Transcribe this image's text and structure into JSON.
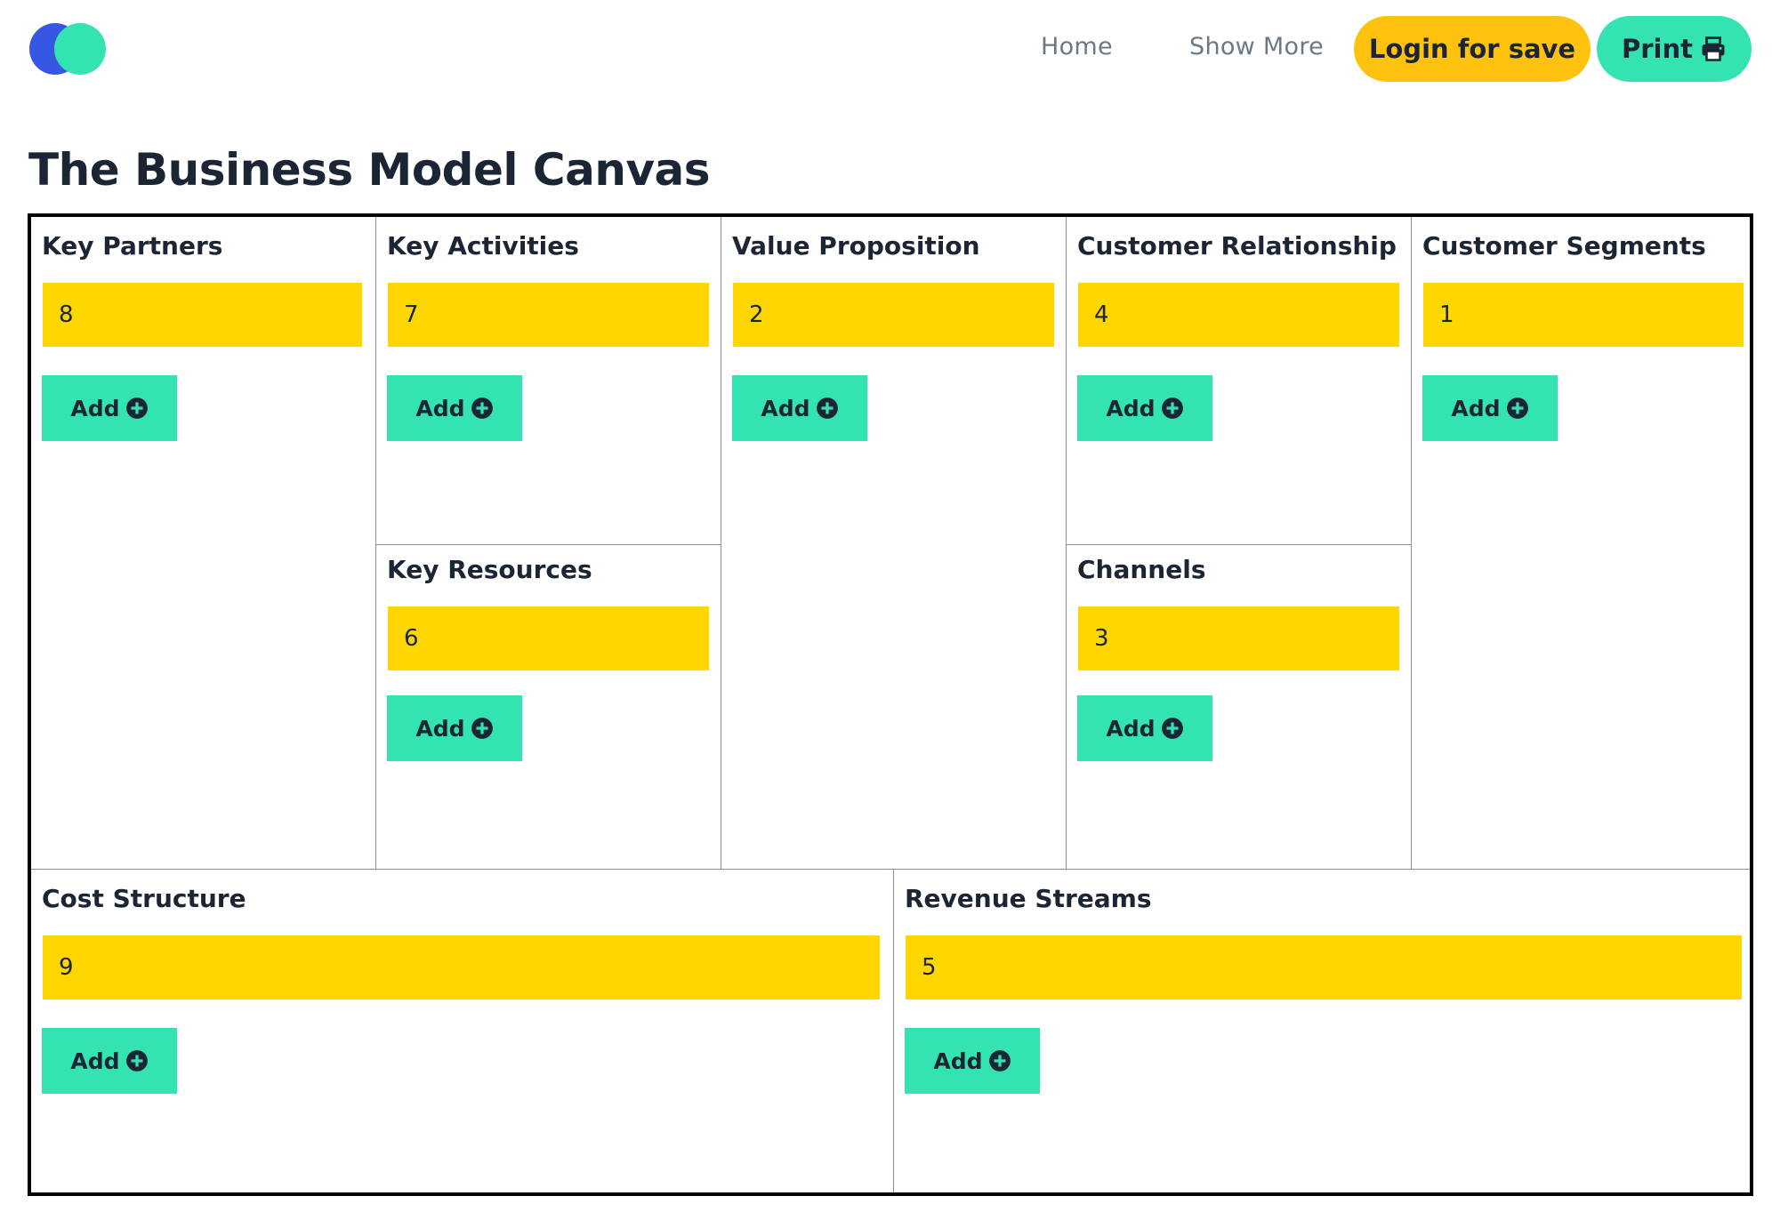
{
  "header": {
    "nav": {
      "home": "Home",
      "show_more": "Show More"
    },
    "login_label": "Login for save",
    "print_label": "Print",
    "print_icon": "printer-icon"
  },
  "page_title": "The Business Model Canvas",
  "colors": {
    "brand_blue": "#3557e3",
    "brand_green": "#33e3b1",
    "login_yellow": "#ffc20e",
    "note_yellow": "#ffd600",
    "text_dark": "#1b2533"
  },
  "canvas": {
    "add_label": "Add",
    "add_icon": "plus-circle-icon",
    "key_partners": {
      "title": "Key Partners",
      "note": "8"
    },
    "key_activities": {
      "title": "Key Activities",
      "note": "7"
    },
    "key_resources": {
      "title": "Key Resources",
      "note": "6"
    },
    "value_proposition": {
      "title": "Value Proposition",
      "note": "2"
    },
    "customer_relationship": {
      "title": "Customer Relationship",
      "note": "4"
    },
    "channels": {
      "title": "Channels",
      "note": "3"
    },
    "customer_segments": {
      "title": "Customer Segments",
      "note": "1"
    },
    "cost_structure": {
      "title": "Cost Structure",
      "note": "9"
    },
    "revenue_streams": {
      "title": "Revenue Streams",
      "note": "5"
    }
  }
}
